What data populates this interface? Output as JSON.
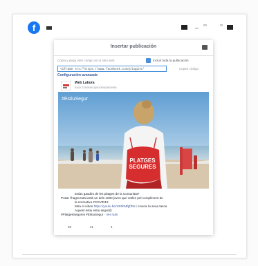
{
  "topbar": {
    "logo_letter": "f"
  },
  "modal": {
    "title": "Insertar publicación",
    "instructions": "Copia y pega este código en tu sitio web",
    "include_full_post_label": "Incluir toda la publicación",
    "include_full_post_checked": true,
    "embed_code": "<iframe src=\"https://www.facebook.com/plugins/",
    "copy_button": "Copiar código",
    "advanced_settings_link": "Configuración avanzada"
  },
  "post": {
    "author": "Web Labora",
    "meta": "hace 3 meses aproximadamente",
    "image_hashtag": "#EstiuSegur",
    "bag_text": "PLATGES SEGURES",
    "text_lines": {
      "l1": "Estàs gaudint de les platges de la Comunitat?",
      "l2": "Posar l'hagra total amb un dels 1000 joves que vetlen pel compliment de",
      "l3": "la normativa #COVID19",
      "l4_pre": "Mira el vídeo ",
      "l4_link": "https://youtu.be/XE9hMfgfZ9c",
      "l4_post": " i conoix la seua tasca",
      "l5": "Aquest estiu estiu segur@",
      "l6_pre": "#PlatgesSegures #EstiuSegur · ",
      "l6_more": "Ver más"
    },
    "reactions": {
      "likes": "93",
      "comments": "21",
      "shares": "4"
    }
  }
}
